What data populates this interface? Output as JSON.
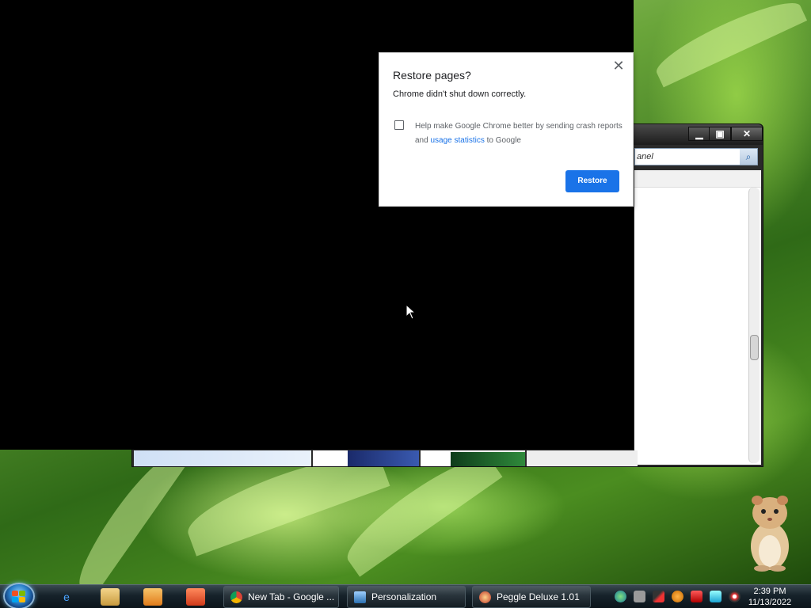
{
  "dialog": {
    "title": "Restore pages?",
    "subtitle": "Chrome didn't shut down correctly.",
    "checkbox_checked": false,
    "help_text_before": "Help make Google Chrome better by sending crash reports and ",
    "help_link": "usage statistics",
    "help_text_after": " to Google",
    "restore_button": "Restore",
    "close_glyph": "✕"
  },
  "explorer": {
    "search_text": "anel",
    "search_icon": "magnifier-icon",
    "minimize_glyph": "▁",
    "maximize_glyph": "▣",
    "close_glyph": "✕"
  },
  "taskbar": {
    "quick_launch": [
      "internet-explorer-icon",
      "windows-explorer-icon",
      "media-player-icon",
      "app-icon"
    ],
    "tasks": [
      {
        "label": "New Tab - Google ...",
        "icon": "chrome-icon"
      },
      {
        "label": "Personalization",
        "icon": "personalization-icon"
      },
      {
        "label": "Peggle Deluxe 1.01",
        "icon": "peggle-icon"
      }
    ],
    "clock": {
      "time": "2:39 PM",
      "date": "11/13/2022"
    }
  },
  "colors": {
    "accent_blue": "#1a73e8",
    "dialog_text": "#202124",
    "muted_text": "#5f6368"
  }
}
